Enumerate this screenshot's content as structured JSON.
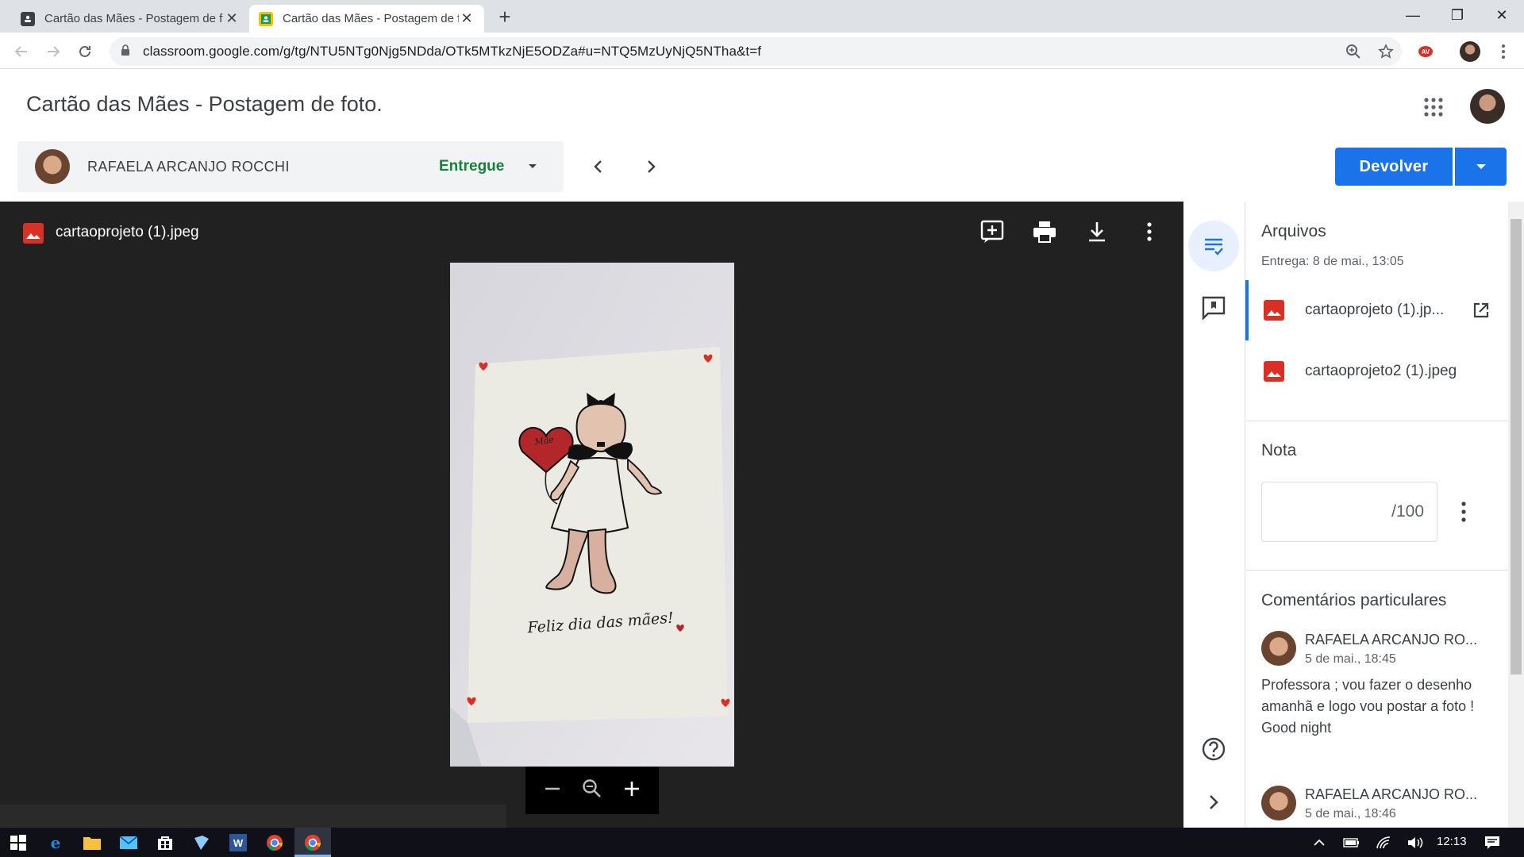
{
  "browser": {
    "tabs": [
      {
        "title": "Cartão das Mães - Postagem de f",
        "active": false
      },
      {
        "title": "Cartão das Mães - Postagem de f",
        "active": true
      }
    ],
    "new_tab_glyph": "+",
    "window_controls": {
      "minimize": "—",
      "maximize": "❐",
      "close": "✕"
    },
    "url": "classroom.google.com/g/tg/NTU5NTg0Njg5NDda/OTk5MTkzNjE5ODZa#u=NTQ5MzUyNjQ5NTha&t=f"
  },
  "header": {
    "title": "Cartão das Mães - Postagem de foto."
  },
  "student": {
    "name": "RAFAELA ARCANJO ROCCHI",
    "status": "Entregue"
  },
  "actions": {
    "return_label": "Devolver"
  },
  "viewer": {
    "file_name": "cartaoprojeto (1).jpeg",
    "card_text": "Feliz dia das mães!",
    "heart_text": "Mãe"
  },
  "panel": {
    "files_title": "Arquivos",
    "files_subtitle": "Entrega: 8 de mai., 13:05",
    "files": [
      {
        "name": "cartaoprojeto (1).jp..."
      },
      {
        "name": "cartaoprojeto2 (1).jpeg"
      }
    ],
    "grade_title": "Nota",
    "grade_suffix": "/100",
    "comments_title": "Comentários particulares",
    "comments": [
      {
        "author": "RAFAELA ARCANJO RO...",
        "time": "5 de mai., 18:45",
        "body": "Professora ; vou fazer o desenho amanhã e logo vou postar a foto ! Good night"
      },
      {
        "author": "RAFAELA ARCANJO RO...",
        "time": "5 de mai., 18:46",
        "body": ""
      }
    ]
  },
  "taskbar": {
    "time": "12:13"
  },
  "colors": {
    "accent": "#1a73e8",
    "status_green": "#188038",
    "viewer_bg": "#212121",
    "image_red": "#d93025"
  }
}
